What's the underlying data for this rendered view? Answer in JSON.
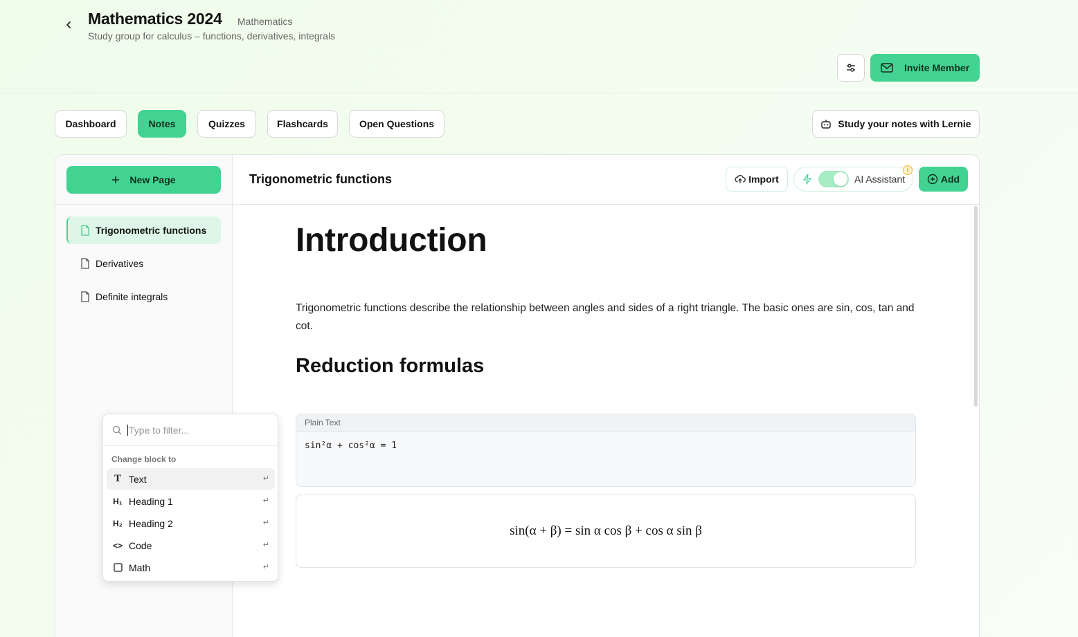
{
  "header": {
    "title": "Mathematics 2024",
    "subject": "Mathematics",
    "subtitle": "Study group for calculus – functions, derivatives, integrals",
    "invite_label": "Invite Member"
  },
  "tabs": [
    {
      "label": "Dashboard"
    },
    {
      "label": "Notes"
    },
    {
      "label": "Quizzes"
    },
    {
      "label": "Flashcards"
    },
    {
      "label": "Open Questions"
    }
  ],
  "active_tab": "Notes",
  "lernie_label": "Study your notes with Lernie",
  "sidebar": {
    "new_page_label": "New Page",
    "pages": [
      {
        "label": "Trigonometric functions"
      },
      {
        "label": "Derivatives"
      },
      {
        "label": "Definite integrals"
      }
    ]
  },
  "toolbar": {
    "doc_title": "Trigonometric functions",
    "import_label": "Import",
    "ai_label": "AI Assistant",
    "ai_enabled": true,
    "add_label": "Add"
  },
  "document": {
    "heading1": "Introduction",
    "paragraph": "Trigonometric functions describe the relationship between angles and sides of a right triangle. The basic ones are sin, cos, tan and cot.",
    "heading2": "Reduction formulas",
    "code_block": {
      "language": "Plain Text",
      "content": "sin²α + cos²α = 1"
    },
    "math_block": "sin(α + β) = sin α cos β + cos α sin β"
  },
  "popup": {
    "search_placeholder": "Type to filter...",
    "section_label": "Change block to",
    "items": [
      {
        "label": "Text",
        "icon": "T",
        "shortcut": "↵"
      },
      {
        "label": "Heading 1",
        "icon": "H₁",
        "shortcut": "↵"
      },
      {
        "label": "Heading 2",
        "icon": "H₂",
        "shortcut": "↵"
      },
      {
        "label": "Code",
        "icon": "<>",
        "shortcut": "↵"
      },
      {
        "label": "Math",
        "icon": "square",
        "shortcut": "↵"
      }
    ]
  },
  "colors": {
    "accent": "#42d392",
    "active_page_bg": "#ddf6e7",
    "background": "#effcea"
  }
}
